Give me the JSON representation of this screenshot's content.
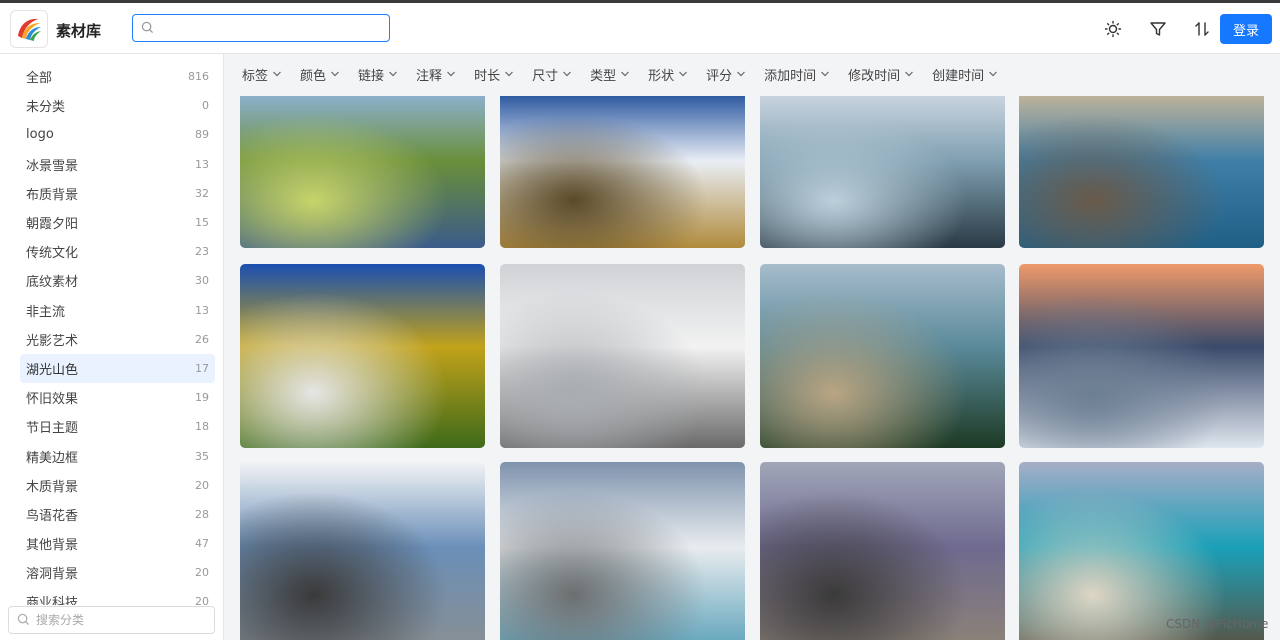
{
  "app": {
    "title": "素材库"
  },
  "search": {
    "value": "",
    "placeholder": ""
  },
  "toolbar": {
    "login_label": "登录"
  },
  "filters": [
    "标签",
    "颜色",
    "链接",
    "注释",
    "时长",
    "尺寸",
    "类型",
    "形状",
    "评分",
    "添加时间",
    "修改时间",
    "创建时间"
  ],
  "categories": [
    {
      "label": "全部",
      "count": "816"
    },
    {
      "label": "未分类",
      "count": "0"
    },
    {
      "label": "logo",
      "count": "89"
    },
    {
      "label": "冰景雪景",
      "count": "13"
    },
    {
      "label": "布质背景",
      "count": "32"
    },
    {
      "label": "朝霞夕阳",
      "count": "15"
    },
    {
      "label": "传统文化",
      "count": "23"
    },
    {
      "label": "底纹素材",
      "count": "30"
    },
    {
      "label": "非主流",
      "count": "13"
    },
    {
      "label": "光影艺术",
      "count": "26"
    },
    {
      "label": "湖光山色",
      "count": "17"
    },
    {
      "label": "怀旧效果",
      "count": "19"
    },
    {
      "label": "节日主题",
      "count": "18"
    },
    {
      "label": "精美边框",
      "count": "35"
    },
    {
      "label": "木质背景",
      "count": "20"
    },
    {
      "label": "鸟语花香",
      "count": "28"
    },
    {
      "label": "其他背景",
      "count": "47"
    },
    {
      "label": "溶洞背景",
      "count": "20"
    },
    {
      "label": "商业科技",
      "count": "20"
    }
  ],
  "active_category_index": 10,
  "category_search": {
    "placeholder": "搜索分类"
  },
  "images": [
    {
      "name": "forest-lake-reflection",
      "colors": [
        "#8fb3d9",
        "#6a8f3a",
        "#3b5b8a",
        "#c8d46a"
      ]
    },
    {
      "name": "snowy-grass-sunburst",
      "colors": [
        "#1f4e9a",
        "#e9eef5",
        "#b08a3a",
        "#5a4a2a"
      ]
    },
    {
      "name": "glacier-river-rocks",
      "colors": [
        "#cfd9e3",
        "#7f9fb0",
        "#2a3a45",
        "#bcd0dc"
      ]
    },
    {
      "name": "lake-jetty",
      "colors": [
        "#c9b79a",
        "#3f7fa8",
        "#1f5f86",
        "#6a5a4a"
      ]
    },
    {
      "name": "golden-poplar-trees",
      "colors": [
        "#1b4fb0",
        "#c2a21a",
        "#3d6a1a",
        "#e6e6e6"
      ]
    },
    {
      "name": "snow-mountain-clouds",
      "colors": [
        "#cfd2d6",
        "#f2f2f2",
        "#6a6a6a",
        "#a9adb2"
      ]
    },
    {
      "name": "lake-pine-mountains",
      "colors": [
        "#a6bccb",
        "#5a8a9a",
        "#1d3a24",
        "#b9a583"
      ]
    },
    {
      "name": "sunset-waves",
      "colors": [
        "#ef9a6a",
        "#3a4a6a",
        "#dfe6ee",
        "#6d7f93"
      ]
    },
    {
      "name": "frost-tree",
      "colors": [
        "#f2f3f5",
        "#6a8fb8",
        "#8a8f92",
        "#3a3a3a"
      ]
    },
    {
      "name": "lake-shore-rocks",
      "colors": [
        "#7f93ad",
        "#e8ecef",
        "#5aa0b8",
        "#6d6f70"
      ]
    },
    {
      "name": "rocky-beach-mountains",
      "colors": [
        "#a0a6b8",
        "#6f6a8f",
        "#8e8476",
        "#3b3a3a"
      ]
    },
    {
      "name": "turquoise-lake-cliffs",
      "colors": [
        "#a7adc7",
        "#1aa0b8",
        "#5c5040",
        "#ddd6c5"
      ]
    }
  ],
  "watermark": "CSDN @PicHome"
}
